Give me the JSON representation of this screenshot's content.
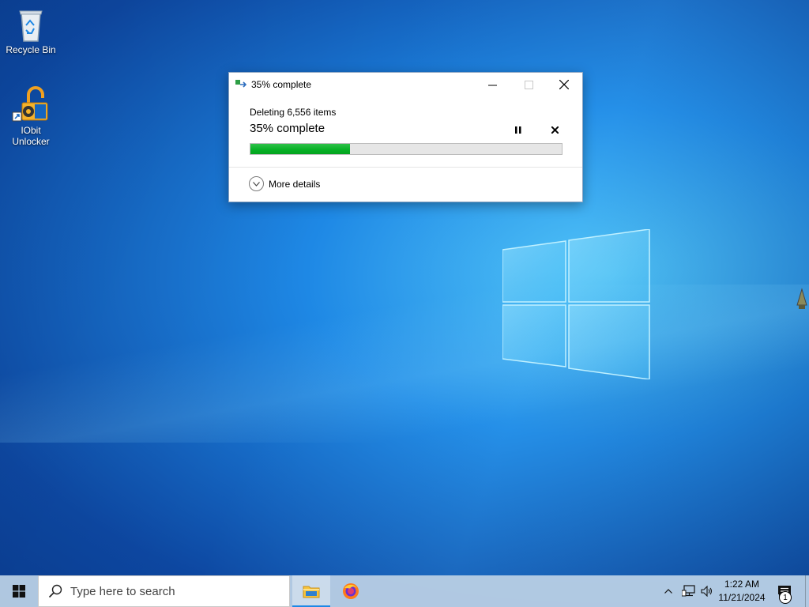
{
  "desktop": {
    "icons": [
      {
        "label": "Recycle Bin",
        "icon": "recycle-bin-icon"
      },
      {
        "label": "IObit Unlocker",
        "icon": "iobit-unlocker-icon"
      }
    ]
  },
  "dialog": {
    "title": "35% complete",
    "operation": "Deleting 6,556 items",
    "progress_text": "35% complete",
    "progress": 0.32,
    "more_details": "More details",
    "icons": {
      "title": "file-copy-icon",
      "pause": "pause-icon",
      "stop": "close-icon",
      "expand": "chevron-down-icon"
    }
  },
  "taskbar": {
    "search_placeholder": "Type here to search",
    "apps": [
      "file-explorer-icon",
      "firefox-icon"
    ],
    "clock": {
      "time": "1:22 AM",
      "date": "11/21/2024"
    },
    "notification_count": "1"
  },
  "colors": {
    "accent": "#06b025",
    "desktop": "#1e88e5"
  }
}
